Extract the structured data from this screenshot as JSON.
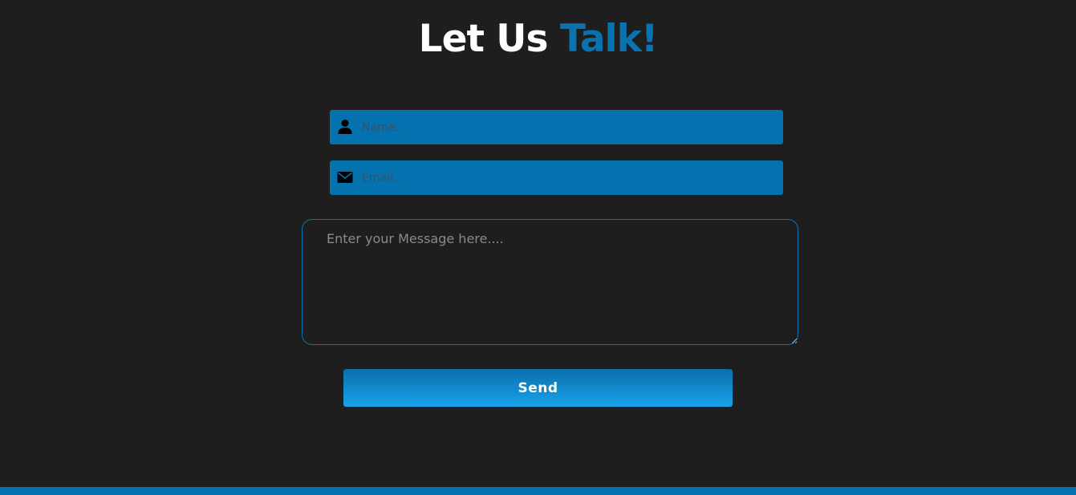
{
  "header": {
    "title_main": "Let Us ",
    "title_accent": "Talk!"
  },
  "form": {
    "name": {
      "icon": "user-icon",
      "placeholder": "Name..",
      "value": ""
    },
    "email": {
      "icon": "envelope-icon",
      "placeholder": "Email..",
      "value": ""
    },
    "message": {
      "placeholder": "Enter your Message here....",
      "value": ""
    },
    "send_label": "Send"
  },
  "colors": {
    "background": "#1e1e1e",
    "accent": "#0572b0",
    "button_gradient_top": "#0a6fac",
    "button_gradient_bottom": "#1aa2ec",
    "title_text": "#ffffff"
  }
}
